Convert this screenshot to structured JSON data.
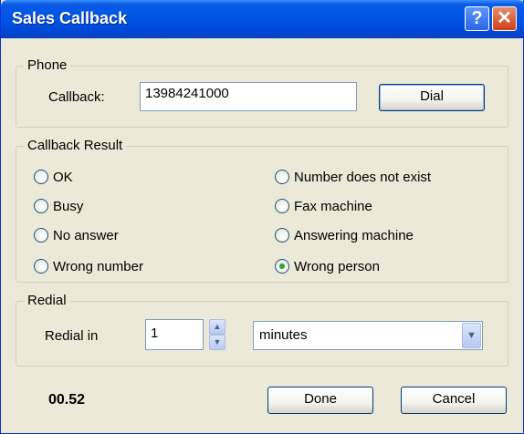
{
  "window": {
    "title": "Sales Callback"
  },
  "titlebar": {
    "help_label": "?",
    "close_label": "✕"
  },
  "phone": {
    "legend": "Phone",
    "callback_label": "Callback:",
    "callback_value": "13984241000",
    "dial_label": "Dial"
  },
  "result": {
    "legend": "Callback Result",
    "options": [
      {
        "label": "OK",
        "selected": false
      },
      {
        "label": "Busy",
        "selected": false
      },
      {
        "label": "No answer",
        "selected": false
      },
      {
        "label": "Wrong number",
        "selected": false
      },
      {
        "label": "Number does not exist",
        "selected": false
      },
      {
        "label": "Fax machine",
        "selected": false
      },
      {
        "label": "Answering machine",
        "selected": false
      },
      {
        "label": "Wrong person",
        "selected": true
      }
    ]
  },
  "redial": {
    "legend": "Redial",
    "label": "Redial in",
    "value": "1",
    "unit": "minutes"
  },
  "footer": {
    "timer": "00.52",
    "done_label": "Done",
    "cancel_label": "Cancel"
  },
  "icons": {
    "up": "spin-up-icon",
    "down": "spin-down-icon",
    "dropdown": "chevron-down-icon"
  }
}
